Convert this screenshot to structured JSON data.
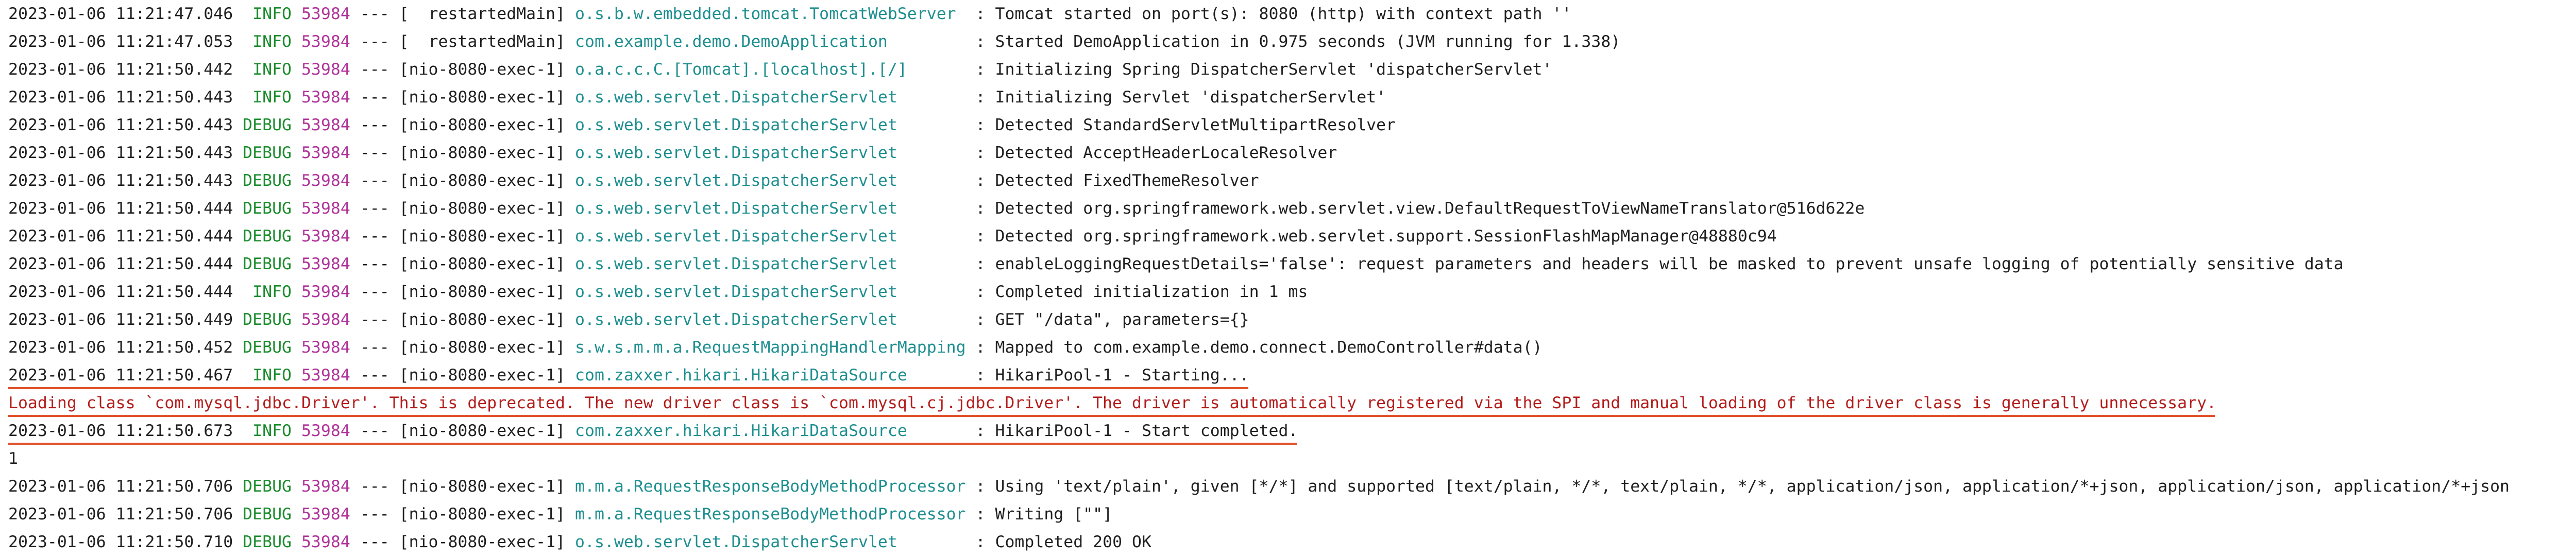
{
  "console": {
    "lines": [
      {
        "kind": "log",
        "date": "2023-01-06",
        "time": "11:21:47.046",
        "level": " INFO",
        "pid": "53984",
        "sep": "---",
        "thread": "[  restartedMain]",
        "logger": "o.s.b.w.embedded.tomcat.TomcatWebServer ",
        "msg": ": Tomcat started on port(s): 8080 (http) with context path ''"
      },
      {
        "kind": "log",
        "date": "2023-01-06",
        "time": "11:21:47.053",
        "level": " INFO",
        "pid": "53984",
        "sep": "---",
        "thread": "[  restartedMain]",
        "logger": "com.example.demo.DemoApplication        ",
        "msg": ": Started DemoApplication in 0.975 seconds (JVM running for 1.338)"
      },
      {
        "kind": "log",
        "date": "2023-01-06",
        "time": "11:21:50.442",
        "level": " INFO",
        "pid": "53984",
        "sep": "---",
        "thread": "[nio-8080-exec-1]",
        "logger": "o.a.c.c.C.[Tomcat].[localhost].[/]      ",
        "msg": ": Initializing Spring DispatcherServlet 'dispatcherServlet'"
      },
      {
        "kind": "log",
        "date": "2023-01-06",
        "time": "11:21:50.443",
        "level": " INFO",
        "pid": "53984",
        "sep": "---",
        "thread": "[nio-8080-exec-1]",
        "logger": "o.s.web.servlet.DispatcherServlet       ",
        "msg": ": Initializing Servlet 'dispatcherServlet'"
      },
      {
        "kind": "log",
        "date": "2023-01-06",
        "time": "11:21:50.443",
        "level": "DEBUG",
        "pid": "53984",
        "sep": "---",
        "thread": "[nio-8080-exec-1]",
        "logger": "o.s.web.servlet.DispatcherServlet       ",
        "msg": ": Detected StandardServletMultipartResolver"
      },
      {
        "kind": "log",
        "date": "2023-01-06",
        "time": "11:21:50.443",
        "level": "DEBUG",
        "pid": "53984",
        "sep": "---",
        "thread": "[nio-8080-exec-1]",
        "logger": "o.s.web.servlet.DispatcherServlet       ",
        "msg": ": Detected AcceptHeaderLocaleResolver"
      },
      {
        "kind": "log",
        "date": "2023-01-06",
        "time": "11:21:50.443",
        "level": "DEBUG",
        "pid": "53984",
        "sep": "---",
        "thread": "[nio-8080-exec-1]",
        "logger": "o.s.web.servlet.DispatcherServlet       ",
        "msg": ": Detected FixedThemeResolver"
      },
      {
        "kind": "log",
        "date": "2023-01-06",
        "time": "11:21:50.444",
        "level": "DEBUG",
        "pid": "53984",
        "sep": "---",
        "thread": "[nio-8080-exec-1]",
        "logger": "o.s.web.servlet.DispatcherServlet       ",
        "msg": ": Detected org.springframework.web.servlet.view.DefaultRequestToViewNameTranslator@516d622e"
      },
      {
        "kind": "log",
        "date": "2023-01-06",
        "time": "11:21:50.444",
        "level": "DEBUG",
        "pid": "53984",
        "sep": "---",
        "thread": "[nio-8080-exec-1]",
        "logger": "o.s.web.servlet.DispatcherServlet       ",
        "msg": ": Detected org.springframework.web.servlet.support.SessionFlashMapManager@48880c94"
      },
      {
        "kind": "log",
        "date": "2023-01-06",
        "time": "11:21:50.444",
        "level": "DEBUG",
        "pid": "53984",
        "sep": "---",
        "thread": "[nio-8080-exec-1]",
        "logger": "o.s.web.servlet.DispatcherServlet       ",
        "msg": ": enableLoggingRequestDetails='false': request parameters and headers will be masked to prevent unsafe logging of potentially sensitive data"
      },
      {
        "kind": "log",
        "date": "2023-01-06",
        "time": "11:21:50.444",
        "level": " INFO",
        "pid": "53984",
        "sep": "---",
        "thread": "[nio-8080-exec-1]",
        "logger": "o.s.web.servlet.DispatcherServlet       ",
        "msg": ": Completed initialization in 1 ms"
      },
      {
        "kind": "log",
        "date": "2023-01-06",
        "time": "11:21:50.449",
        "level": "DEBUG",
        "pid": "53984",
        "sep": "---",
        "thread": "[nio-8080-exec-1]",
        "logger": "o.s.web.servlet.DispatcherServlet       ",
        "msg": ": GET \"/data\", parameters={}"
      },
      {
        "kind": "log",
        "date": "2023-01-06",
        "time": "11:21:50.452",
        "level": "DEBUG",
        "pid": "53984",
        "sep": "---",
        "thread": "[nio-8080-exec-1]",
        "logger": "s.w.s.m.m.a.RequestMappingHandlerMapping",
        "msg": ": Mapped to com.example.demo.connect.DemoController#data()"
      },
      {
        "kind": "log",
        "date": "2023-01-06",
        "time": "11:21:50.467",
        "level": " INFO",
        "pid": "53984",
        "sep": "---",
        "thread": "[nio-8080-exec-1]",
        "logger": "com.zaxxer.hikari.HikariDataSource      ",
        "msg": ": HikariPool-1 - Starting...",
        "underline": true
      },
      {
        "kind": "error",
        "text": "Loading class `com.mysql.jdbc.Driver'. This is deprecated. The new driver class is `com.mysql.cj.jdbc.Driver'. The driver is automatically registered via the SPI and manual loading of the driver class is generally unnecessary.",
        "underline": true
      },
      {
        "kind": "log",
        "date": "2023-01-06",
        "time": "11:21:50.673",
        "level": " INFO",
        "pid": "53984",
        "sep": "---",
        "thread": "[nio-8080-exec-1]",
        "logger": "com.zaxxer.hikari.HikariDataSource      ",
        "msg": ": HikariPool-1 - Start completed.",
        "underline": true
      },
      {
        "kind": "plain",
        "text": "1"
      },
      {
        "kind": "log",
        "date": "2023-01-06",
        "time": "11:21:50.706",
        "level": "DEBUG",
        "pid": "53984",
        "sep": "---",
        "thread": "[nio-8080-exec-1]",
        "logger": "m.m.a.RequestResponseBodyMethodProcessor",
        "msg": ": Using 'text/plain', given [*/*] and supported [text/plain, */*, text/plain, */*, application/json, application/*+json, application/json, application/*+json"
      },
      {
        "kind": "log",
        "date": "2023-01-06",
        "time": "11:21:50.706",
        "level": "DEBUG",
        "pid": "53984",
        "sep": "---",
        "thread": "[nio-8080-exec-1]",
        "logger": "m.m.a.RequestResponseBodyMethodProcessor",
        "msg": ": Writing [\"\"]"
      },
      {
        "kind": "log",
        "date": "2023-01-06",
        "time": "11:21:50.710",
        "level": "DEBUG",
        "pid": "53984",
        "sep": "---",
        "thread": "[nio-8080-exec-1]",
        "logger": "o.s.web.servlet.DispatcherServlet       ",
        "msg": ": Completed 200 OK"
      }
    ]
  }
}
